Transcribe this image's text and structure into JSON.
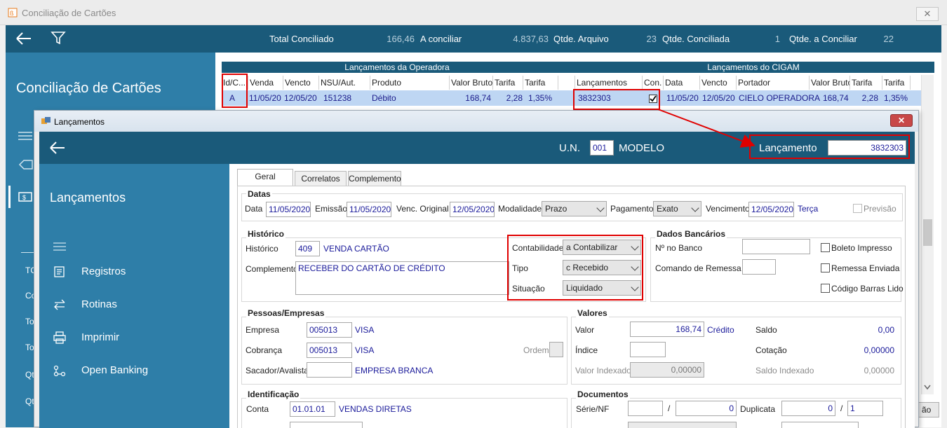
{
  "window": {
    "title": "Conciliação de Cartões"
  },
  "topbar": {
    "stats": [
      {
        "label": "Total Conciliado",
        "value": "166,46"
      },
      {
        "label": "A conciliar",
        "value": "4.837,63"
      },
      {
        "label": "Qtde. Arquivo",
        "value": "23"
      },
      {
        "label": "Qtde. Conciliada",
        "value": "1"
      },
      {
        "label": "Qtde. a Conciliar",
        "value": "22"
      }
    ]
  },
  "left_nav": {
    "title": "Conciliação de Cartões",
    "fragments": [
      "TC",
      "Co",
      "To",
      "To",
      "Qt",
      "Qt"
    ]
  },
  "grid": {
    "group_operadora": "Lançamentos da Operadora",
    "group_cigam": "Lançamentos do CIGAM",
    "columns": [
      "Id/C...",
      "Venda",
      "Vencto",
      "NSU/Aut.",
      "Produto",
      "Valor Bruto",
      "Tarifa",
      "Tarifa",
      "Lançamentos",
      "Con.",
      "Data",
      "Vencto",
      "Portador",
      "Valor Bruto",
      "Tarifa",
      "Tarifa"
    ],
    "row": {
      "id": "A",
      "venda": "11/05/20",
      "vencto": "12/05/20",
      "nsu": "151238",
      "produto": "Débito",
      "valor_bruto": "168,74",
      "tarifa": "2,28",
      "tarifa_pct": "1,35%",
      "lancamento": "3832303",
      "conciliado": true,
      "data": "11/05/20",
      "vencto2": "12/05/20",
      "portador": "CIELO OPERADORA",
      "valor_bruto2": "168,74",
      "tarifa2": "2,28",
      "tarifa_pct2": "1,35%"
    },
    "partial_button": "ão"
  },
  "dialog": {
    "title": "Lançamentos",
    "header": {
      "un_label": "U.N.",
      "un_value": "001",
      "modelo": "MODELO",
      "lancamento_label": "Lançamento",
      "lancamento_value": "3832303"
    },
    "sidebar": {
      "title": "Lançamentos",
      "items": [
        {
          "label": "Registros",
          "icon": "book-icon"
        },
        {
          "label": "Rotinas",
          "icon": "swap-arrows-icon"
        },
        {
          "label": "Imprimir",
          "icon": "printer-icon"
        },
        {
          "label": "Open Banking",
          "icon": "network-icon"
        }
      ]
    },
    "tabs": [
      "Geral",
      "Correlatos",
      "Complemento"
    ],
    "datas": {
      "title": "Datas",
      "data_label": "Data",
      "data": "11/05/2020",
      "emissao_label": "Emissão",
      "emissao": "11/05/2020",
      "venc_original_label": "Venc. Original",
      "venc_original": "12/05/2020",
      "modalidade_label": "Modalidade",
      "modalidade": "Prazo",
      "pagamento_label": "Pagamento",
      "pagamento": "Exato",
      "vencimento_label": "Vencimento",
      "vencimento": "12/05/2020",
      "dia_semana": "Terça",
      "previsao_label": "Previsão"
    },
    "historico": {
      "title": "Histórico",
      "historico_label": "Histórico",
      "historico_code": "409",
      "historico_desc": "VENDA CARTÃO",
      "complemento_label": "Complemento",
      "complemento": "RECEBER DO CARTÃO DE CRÉDITO",
      "contabilidade_label": "Contabilidade",
      "contabilidade": "a Contabilizar",
      "tipo_label": "Tipo",
      "tipo": "c Recebido",
      "situacao_label": "Situação",
      "situacao": "Liquidado"
    },
    "dados_bancarios": {
      "title": "Dados Bancários",
      "no_banco_label": "Nº no Banco",
      "comando_remessa_label": "Comando de Remessa",
      "boleto_impresso": "Boleto Impresso",
      "remessa_enviada": "Remessa Enviada",
      "codigo_barras_lido": "Código Barras Lido"
    },
    "pessoas": {
      "title": "Pessoas/Empresas",
      "empresa_label": "Empresa",
      "empresa_code": "005013",
      "empresa_name": "VISA",
      "cobranca_label": "Cobrança",
      "cobranca_code": "005013",
      "cobranca_name": "VISA",
      "ordem_label": "Ordem",
      "sacador_label": "Sacador/Avalista",
      "sacador_name": "EMPRESA BRANCA"
    },
    "valores": {
      "title": "Valores",
      "valor_label": "Valor",
      "valor": "168,74",
      "valor_tipo": "Crédito",
      "indice_label": "Índice",
      "valor_indexado_label": "Valor Indexado",
      "valor_indexado": "0,00000",
      "saldo_label": "Saldo",
      "saldo": "0,00",
      "cotacao_label": "Cotação",
      "cotacao": "0,00000",
      "saldo_indexado_label": "Saldo Indexado",
      "saldo_indexado": "0,00000"
    },
    "identificacao": {
      "title": "Identificação",
      "conta_label": "Conta",
      "conta_code": "01.01.01",
      "conta_desc": "VENDAS DIRETAS"
    },
    "documentos": {
      "title": "Documentos",
      "serie_nf_label": "Série/NF",
      "nf_value": "0",
      "duplicata_label": "Duplicata",
      "duplicata_value": "0",
      "duplicata_seq": "1",
      "slash": "/"
    }
  },
  "colors": {
    "header_blue": "#1a5a7a",
    "sidebar_blue": "#2e7ea8",
    "highlight": "#e00000",
    "row_select": "#bed6f3",
    "value_text": "#1a1a9a"
  }
}
